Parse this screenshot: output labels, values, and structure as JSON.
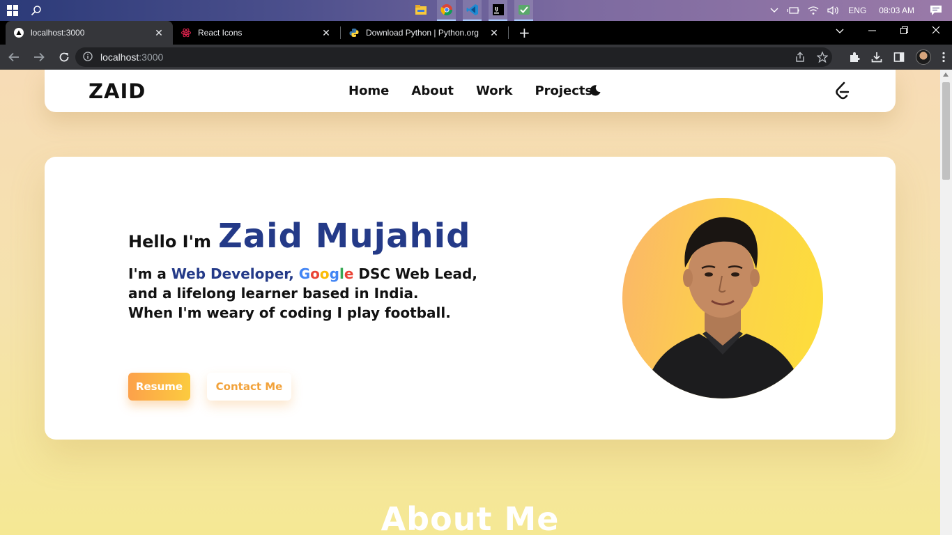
{
  "taskbar": {
    "apps": [
      "file-explorer-icon",
      "chrome-icon",
      "vscode-icon",
      "intellij-icon",
      "app-icon"
    ],
    "language": "ENG",
    "time": "08:03 AM"
  },
  "browser": {
    "tabs": [
      {
        "title": "localhost:3000",
        "icon": "vercel-icon"
      },
      {
        "title": "React Icons",
        "icon": "react-icon"
      },
      {
        "title": "Download Python | Python.org",
        "icon": "python-icon"
      }
    ],
    "url_host": "localhost",
    "url_port": ":3000"
  },
  "page": {
    "logo": "ZAID",
    "nav": [
      "Home",
      "About",
      "Work",
      "Projects"
    ],
    "hero": {
      "greeting": "Hello I'm",
      "name": "Zaid Mujahid",
      "line1_pre": "I'm a ",
      "line1_role": "Web Developer",
      "line1_comma": ", ",
      "google": [
        "G",
        "o",
        "o",
        "g",
        "l",
        "e"
      ],
      "line1_post": " DSC Web Lead,",
      "line2": "and a lifelong learner based in India.",
      "line3": "When I'm weary of coding I play football.",
      "resume_label": "Resume",
      "contact_label": "Contact Me"
    },
    "about_title": "About Me"
  },
  "colors": {
    "accent": "#243a88",
    "button_orange": "#fca14a",
    "button_yellow": "#fccb3f"
  }
}
